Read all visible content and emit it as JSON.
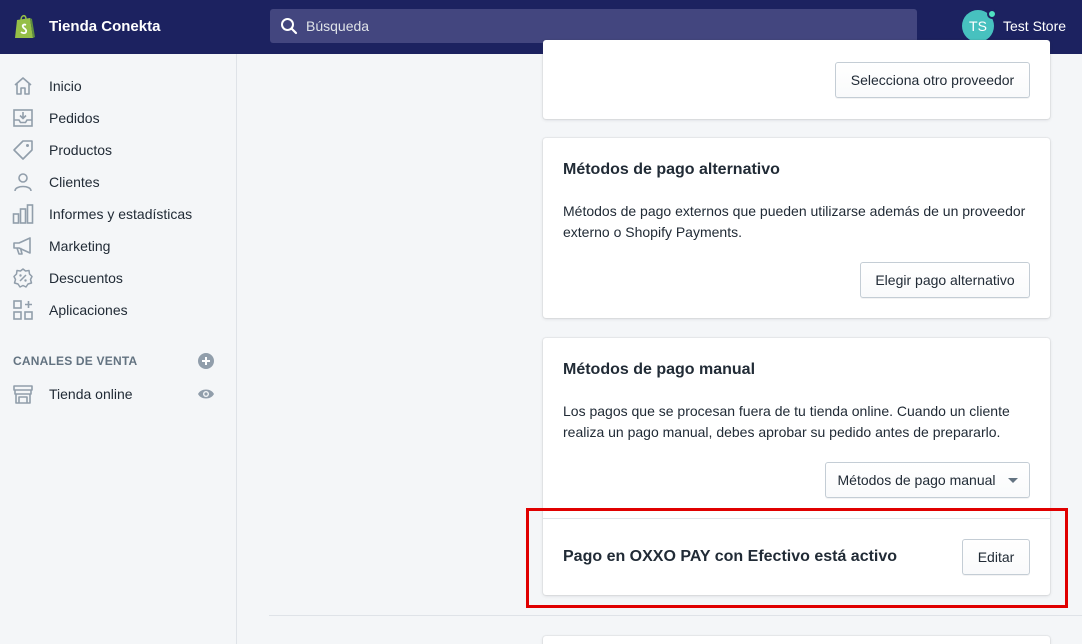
{
  "header": {
    "store_name": "Tienda Conekta",
    "search_placeholder": "Búsqueda",
    "user_initials": "TS",
    "user_name": "Test Store"
  },
  "sidebar": {
    "items": [
      {
        "label": "Inicio",
        "icon": "home-icon"
      },
      {
        "label": "Pedidos",
        "icon": "orders-icon"
      },
      {
        "label": "Productos",
        "icon": "tag-icon"
      },
      {
        "label": "Clientes",
        "icon": "person-icon"
      },
      {
        "label": "Informes y estadísticas",
        "icon": "bar-chart-icon"
      },
      {
        "label": "Marketing",
        "icon": "megaphone-icon"
      },
      {
        "label": "Descuentos",
        "icon": "discount-icon"
      },
      {
        "label": "Aplicaciones",
        "icon": "apps-icon"
      }
    ],
    "sales_channels_title": "CANALES DE VENTA",
    "channels": [
      {
        "label": "Tienda online",
        "icon": "store-icon"
      }
    ]
  },
  "cards": {
    "provider": {
      "button": "Selecciona otro proveedor"
    },
    "alternative": {
      "title": "Métodos de pago alternativo",
      "description": "Métodos de pago externos que pueden utilizarse además de un proveedor externo o Shopify Payments.",
      "button": "Elegir pago alternativo"
    },
    "manual": {
      "title": "Métodos de pago manual",
      "description": "Los pagos que se procesan fuera de tu tienda online. Cuando un cliente realiza un pago manual, debes aprobar su pedido antes de prepararlo.",
      "dropdown": "Métodos de pago manual",
      "active_text": "Pago en OXXO PAY con Efectivo está activo",
      "edit_button": "Editar"
    }
  },
  "colors": {
    "topbar": "#1c2260",
    "highlight": "#e00000",
    "avatar": "#47c1bf"
  }
}
